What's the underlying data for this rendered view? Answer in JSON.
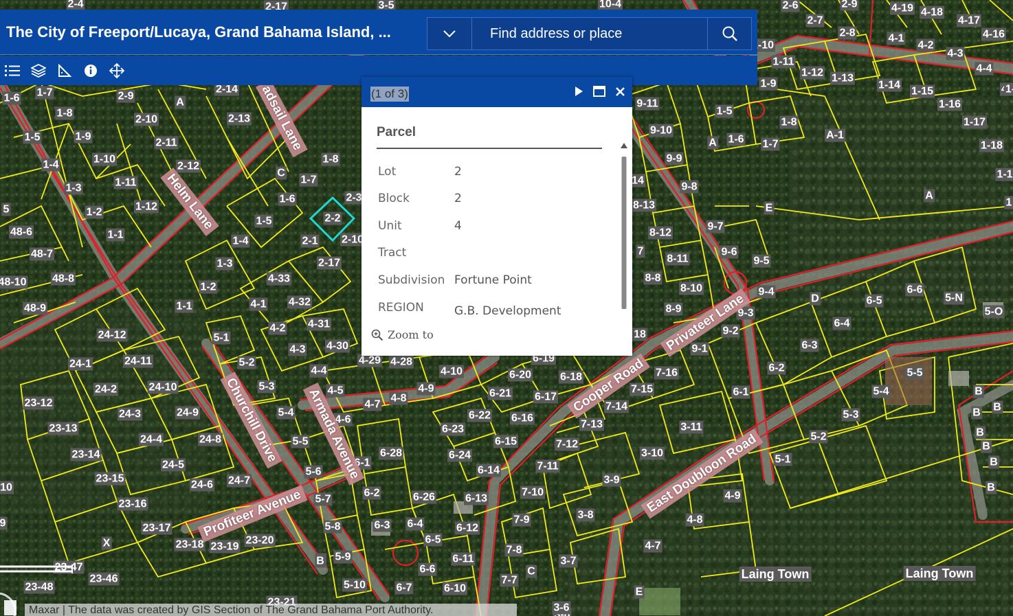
{
  "header": {
    "title": "The City of Freeport/Lucaya, Grand Bahama Island, ...",
    "search_placeholder": "Find address or place"
  },
  "toolbar": {
    "tools": [
      "list-icon",
      "layers-icon",
      "measure-icon",
      "info-icon",
      "locate-icon"
    ]
  },
  "popup": {
    "count": "(1 of 3)",
    "title": "Parcel",
    "fields": [
      {
        "key": "Lot",
        "value": "2"
      },
      {
        "key": "Block",
        "value": "2"
      },
      {
        "key": "Unit",
        "value": "4"
      },
      {
        "key": "Tract",
        "value": ""
      },
      {
        "key": "Subdivision",
        "value": "Fortune Point"
      },
      {
        "key": "REGION",
        "value": "G.B. Development Company"
      }
    ],
    "zoom_label": "Zoom to"
  },
  "attribution": "Maxar | The data was created by GIS Section of The Grand Bahama Port Authority.",
  "streets": [
    "Helm Lane",
    "Churchill Drive",
    "Armada Avenue",
    "Profiteer Avenue",
    "Cooper Road",
    "Privateer Lane",
    "East Doubloon Road",
    "adsail Lane"
  ],
  "towns": [
    "Laing Town",
    "Laing Town"
  ],
  "parcel_labels": [
    "2-4",
    "3-6",
    "2-17",
    "3-5",
    "10-4",
    "2-6",
    "2-9",
    "4-19",
    "4-18",
    "4-17",
    "4-16",
    "2-7",
    "2-8",
    "4-1",
    "4-2",
    "4-3",
    "4-4",
    "1-10",
    "1-11",
    "1-12",
    "1-13",
    "1-14",
    "1-15",
    "1-16",
    "1-17",
    "1-18",
    "4-",
    "1-9",
    "2-14",
    "2-13",
    "2-9",
    "1-7",
    "1-6",
    "A",
    "1-8",
    "2-10",
    "2-11",
    "2-12",
    "1-5",
    "1-9",
    "1-4",
    "1-10",
    "1-11",
    "1-3",
    "1-2",
    "1-12",
    "1-1",
    "5",
    "48-6",
    "48-7",
    "48-10",
    "48-8",
    "48-9",
    "C",
    "1-7",
    "1-8",
    "1-6",
    "1-5",
    "1-4",
    "1-3",
    "1-2",
    "1-1",
    "2-2",
    "2-3",
    "2-1",
    "2-10",
    "2-17",
    "4-33",
    "4-32",
    "4-31",
    "4-30",
    "4-1",
    "4-2",
    "4-3",
    "4-4",
    "5-1",
    "5-2",
    "5-3",
    "5-4",
    "5-5",
    "5-6",
    "5-7",
    "5-8",
    "5-9",
    "5-10",
    "4-29",
    "4-28",
    "4-5",
    "4-6",
    "4-7",
    "4-8",
    "4-9",
    "4-10",
    "24-12",
    "24-1",
    "24-11",
    "24-2",
    "24-10",
    "24-3",
    "24-9",
    "24-4",
    "24-8",
    "24-5",
    "24-6",
    "24-7",
    "23-12",
    "23-13",
    "23-14",
    "23-15",
    "23-16",
    "23-17",
    "23-18",
    "23-19",
    "23-20",
    "23-21",
    "23-46",
    "23-48",
    "23-47",
    "X",
    "B",
    "6-1",
    "6-2",
    "6-3",
    "6-4",
    "6-5",
    "6-6",
    "6-7",
    "6-10",
    "6-11",
    "6-12",
    "6-13",
    "6-14",
    "6-15",
    "6-16",
    "6-17",
    "6-18",
    "6-19",
    "6-20",
    "6-21",
    "6-22",
    "6-23",
    "6-24",
    "6-26",
    "6-28",
    "7-1",
    "7-7",
    "7-8",
    "7-9",
    "7-10",
    "7-11",
    "7-12",
    "7-13",
    "7-14",
    "7-15",
    "7-16",
    "C",
    "9-11",
    "9-10",
    "9-9",
    "9-8",
    "8-13",
    "8-12",
    "8-11",
    "8-10",
    "8-9",
    "8-8",
    "9-7",
    "9-6",
    "9-5",
    "9-4",
    "9-3",
    "9-2",
    "9-1",
    "14",
    "7",
    "18",
    "1-5",
    "1-6",
    "1-7",
    "1-8",
    "A",
    "A-1",
    "E",
    "A",
    "D",
    "6-5",
    "6-6",
    "5-N",
    "5-O",
    "6-4",
    "6-3",
    "6-2",
    "6-1",
    "5-5",
    "5-4",
    "5-3",
    "5-2",
    "5-1",
    "3-11",
    "3-10",
    "3-9",
    "3-8",
    "3-7",
    "3-6",
    "4-9",
    "4-8",
    "4-7",
    "E",
    "B",
    "B",
    "B",
    "B",
    "B",
    "B",
    "B",
    "B",
    "1-1",
    "1-",
    "1",
    "10",
    "9"
  ]
}
